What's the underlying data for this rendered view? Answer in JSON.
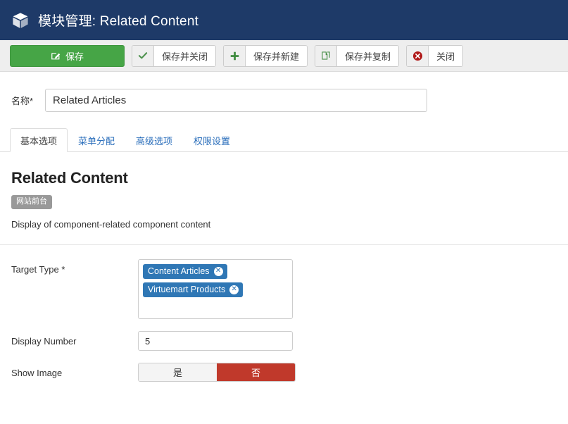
{
  "header": {
    "icon": "cube-icon",
    "title": "模块管理: Related Content",
    "bg_color": "#1e3a68"
  },
  "toolbar": {
    "save": {
      "label": "保存",
      "icon": "pencil-square-icon",
      "color": "#46a546"
    },
    "save_close": {
      "label": "保存并关闭",
      "icon": "check-icon"
    },
    "save_new": {
      "label": "保存并新建",
      "icon": "plus-icon"
    },
    "save_copy": {
      "label": "保存并复制",
      "icon": "copy-icon"
    },
    "close": {
      "label": "关闭",
      "icon": "close-circle-icon"
    }
  },
  "name_field": {
    "label": "名称",
    "required_mark": "*",
    "value": "Related Articles",
    "placeholder": ""
  },
  "tabs": [
    {
      "label": "基本选项",
      "active": true
    },
    {
      "label": "菜单分配",
      "active": false
    },
    {
      "label": "高级选项",
      "active": false
    },
    {
      "label": "权限设置",
      "active": false
    }
  ],
  "module": {
    "title": "Related Content",
    "badge": "网站前台",
    "description": "Display of component-related component content"
  },
  "form": {
    "target_type": {
      "label": "Target Type",
      "required_mark": "*",
      "chips": [
        {
          "label": "Content Articles",
          "remove_icon": "close-circle-icon"
        },
        {
          "label": "Virtuemart Products",
          "remove_icon": "close-circle-icon"
        }
      ],
      "chip_color": "#2f77b5"
    },
    "display_number": {
      "label": "Display Number",
      "value": "5",
      "placeholder": ""
    },
    "show_image": {
      "label": "Show Image",
      "yes_label": "是",
      "no_label": "否",
      "selected": "否",
      "selected_color": "#c0392b"
    }
  }
}
